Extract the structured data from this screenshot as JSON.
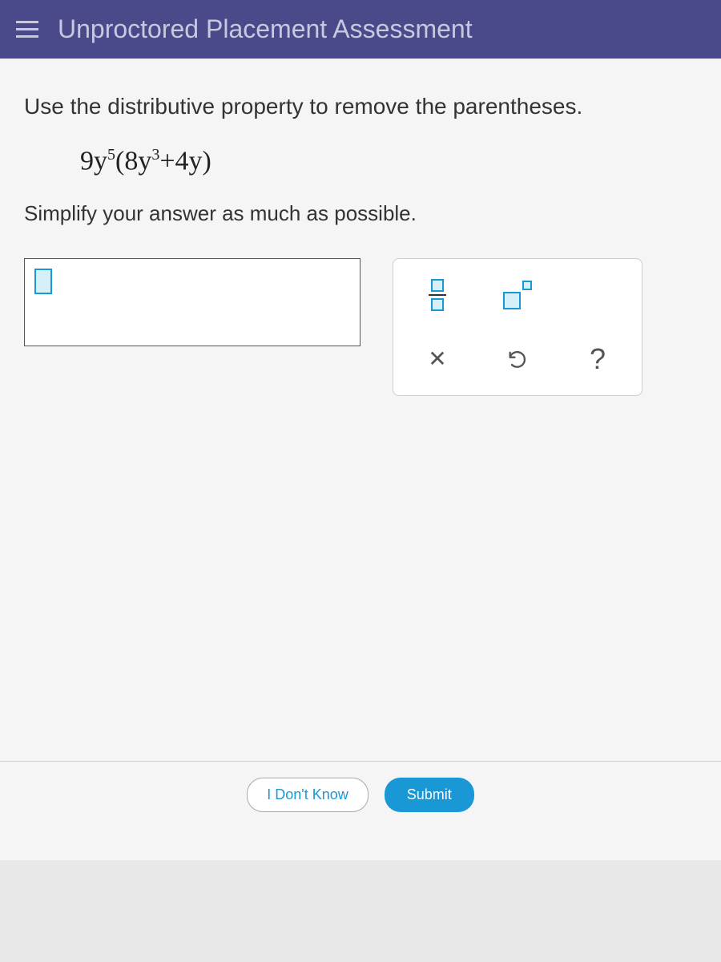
{
  "header": {
    "title": "Unproctored Placement Assessment"
  },
  "problem": {
    "instruction1": "Use the distributive property to remove the parentheses.",
    "expression_coef1": "9",
    "expression_var1": "y",
    "expression_exp1": "5",
    "expression_open": "(",
    "expression_coef2": "8",
    "expression_var2": "y",
    "expression_exp2": "3",
    "expression_plus": "+4",
    "expression_var3": "y",
    "expression_close": ")",
    "instruction2": "Simplify your answer as much as possible."
  },
  "footer": {
    "idk": "I Don't Know",
    "submit": "Submit"
  },
  "tools": {
    "help": "?",
    "clear": "✕"
  }
}
